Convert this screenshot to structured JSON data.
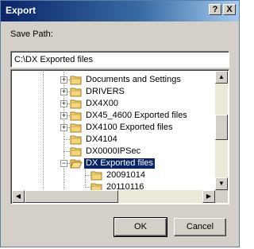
{
  "dialog": {
    "title": "Export",
    "help_label": "?",
    "close_label": "X",
    "save_path_label": "Save Path:",
    "save_path_value": "C:\\DX Exported files",
    "ok_label": "OK",
    "cancel_label": "Cancel"
  },
  "tree": {
    "nodes": [
      {
        "label": "Documents and Settings",
        "expander": "+",
        "selected": false
      },
      {
        "label": "DRIVERS",
        "expander": "+",
        "selected": false
      },
      {
        "label": "DX4X00",
        "expander": "+",
        "selected": false
      },
      {
        "label": "DX45_4600 Exported files",
        "expander": "+",
        "selected": false
      },
      {
        "label": "DX4100 Exported files",
        "expander": "+",
        "selected": false
      },
      {
        "label": "DX4104",
        "expander": "",
        "selected": false
      },
      {
        "label": "DX0000IPSec",
        "expander": "",
        "selected": false
      },
      {
        "label": "DX Exported files",
        "expander": "−",
        "selected": true
      },
      {
        "label": "20091014",
        "expander": "",
        "selected": false
      },
      {
        "label": "20110116",
        "expander": "",
        "selected": false
      }
    ]
  },
  "icons": {
    "folder": "folder-icon",
    "open_folder": "open-folder-icon",
    "scroll_up": "scroll-up-arrow-icon",
    "scroll_down": "scroll-down-arrow-icon",
    "scroll_left": "scroll-left-arrow-icon",
    "scroll_right": "scroll-right-arrow-icon"
  },
  "colors": {
    "title_bar": "#0a246a",
    "selection": "#0a246a",
    "dialog_face": "#d4d0c8",
    "folder_yellow": "#f4d57a"
  }
}
